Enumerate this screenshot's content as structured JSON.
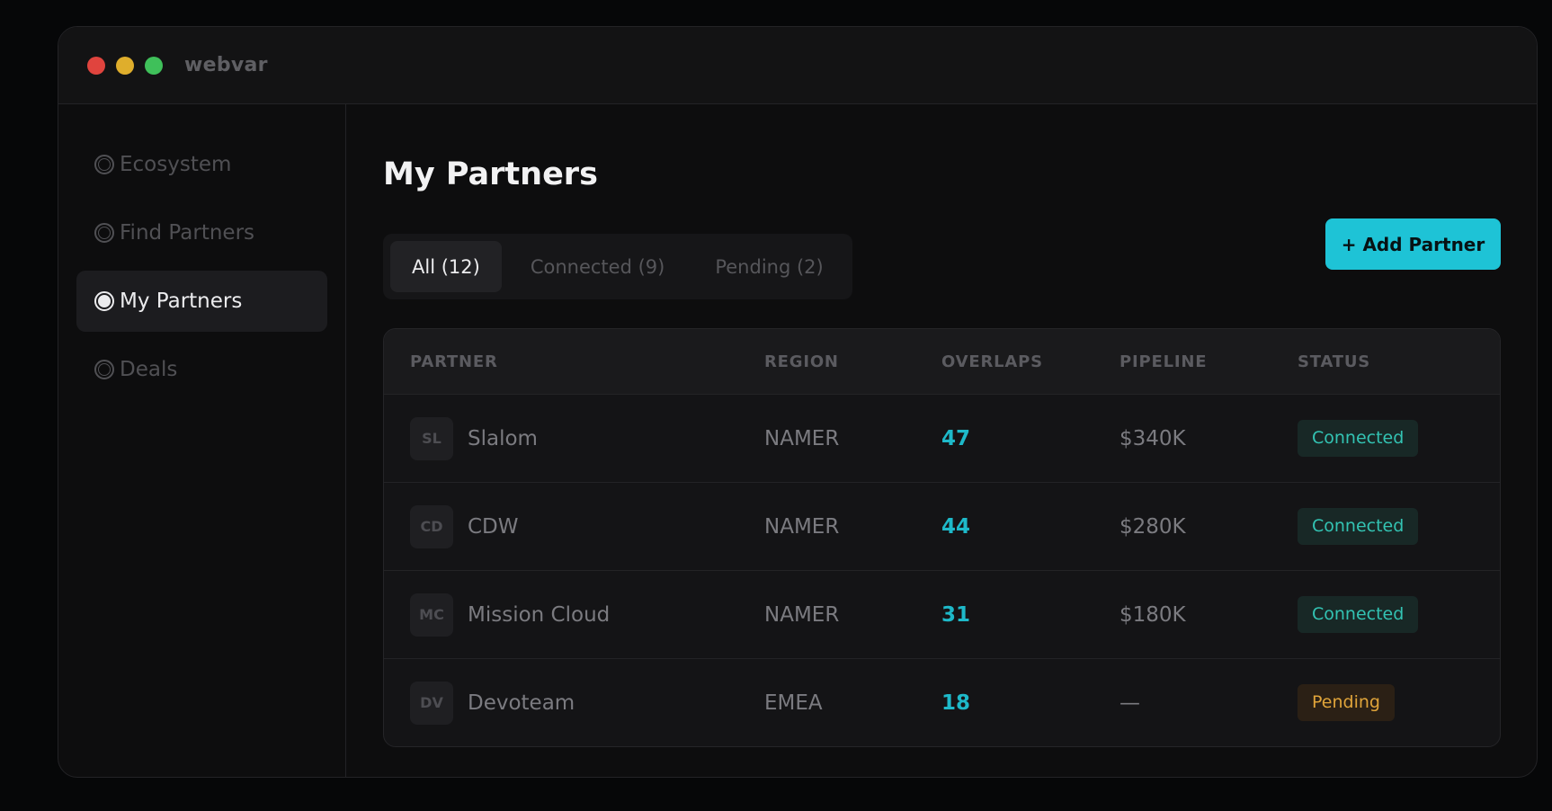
{
  "window": {
    "title": "webvar"
  },
  "sidebar": {
    "items": [
      {
        "label": "Ecosystem",
        "active": false
      },
      {
        "label": "Find Partners",
        "active": false
      },
      {
        "label": "My Partners",
        "active": true
      },
      {
        "label": "Deals",
        "active": false
      }
    ]
  },
  "main": {
    "title": "My Partners",
    "add_button": "+ Add Partner",
    "tabs": [
      {
        "label": "All (12)",
        "active": true
      },
      {
        "label": "Connected (9)",
        "active": false
      },
      {
        "label": "Pending (2)",
        "active": false
      }
    ],
    "table": {
      "headers": [
        "PARTNER",
        "REGION",
        "OVERLAPS",
        "PIPELINE",
        "STATUS"
      ],
      "rows": [
        {
          "initials": "SL",
          "partner": "Slalom",
          "region": "NAMER",
          "overlaps": "47",
          "pipeline": "$340K",
          "status": "Connected"
        },
        {
          "initials": "CD",
          "partner": "CDW",
          "region": "NAMER",
          "overlaps": "44",
          "pipeline": "$280K",
          "status": "Connected"
        },
        {
          "initials": "MC",
          "partner": "Mission Cloud",
          "region": "NAMER",
          "overlaps": "31",
          "pipeline": "$180K",
          "status": "Connected"
        },
        {
          "initials": "DV",
          "partner": "Devoteam",
          "region": "EMEA",
          "overlaps": "18",
          "pipeline": "—",
          "status": "Pending"
        }
      ]
    }
  },
  "colors": {
    "accent": "#1ec3d6",
    "connected": "#33c3b3",
    "pending": "#e0a43a"
  }
}
